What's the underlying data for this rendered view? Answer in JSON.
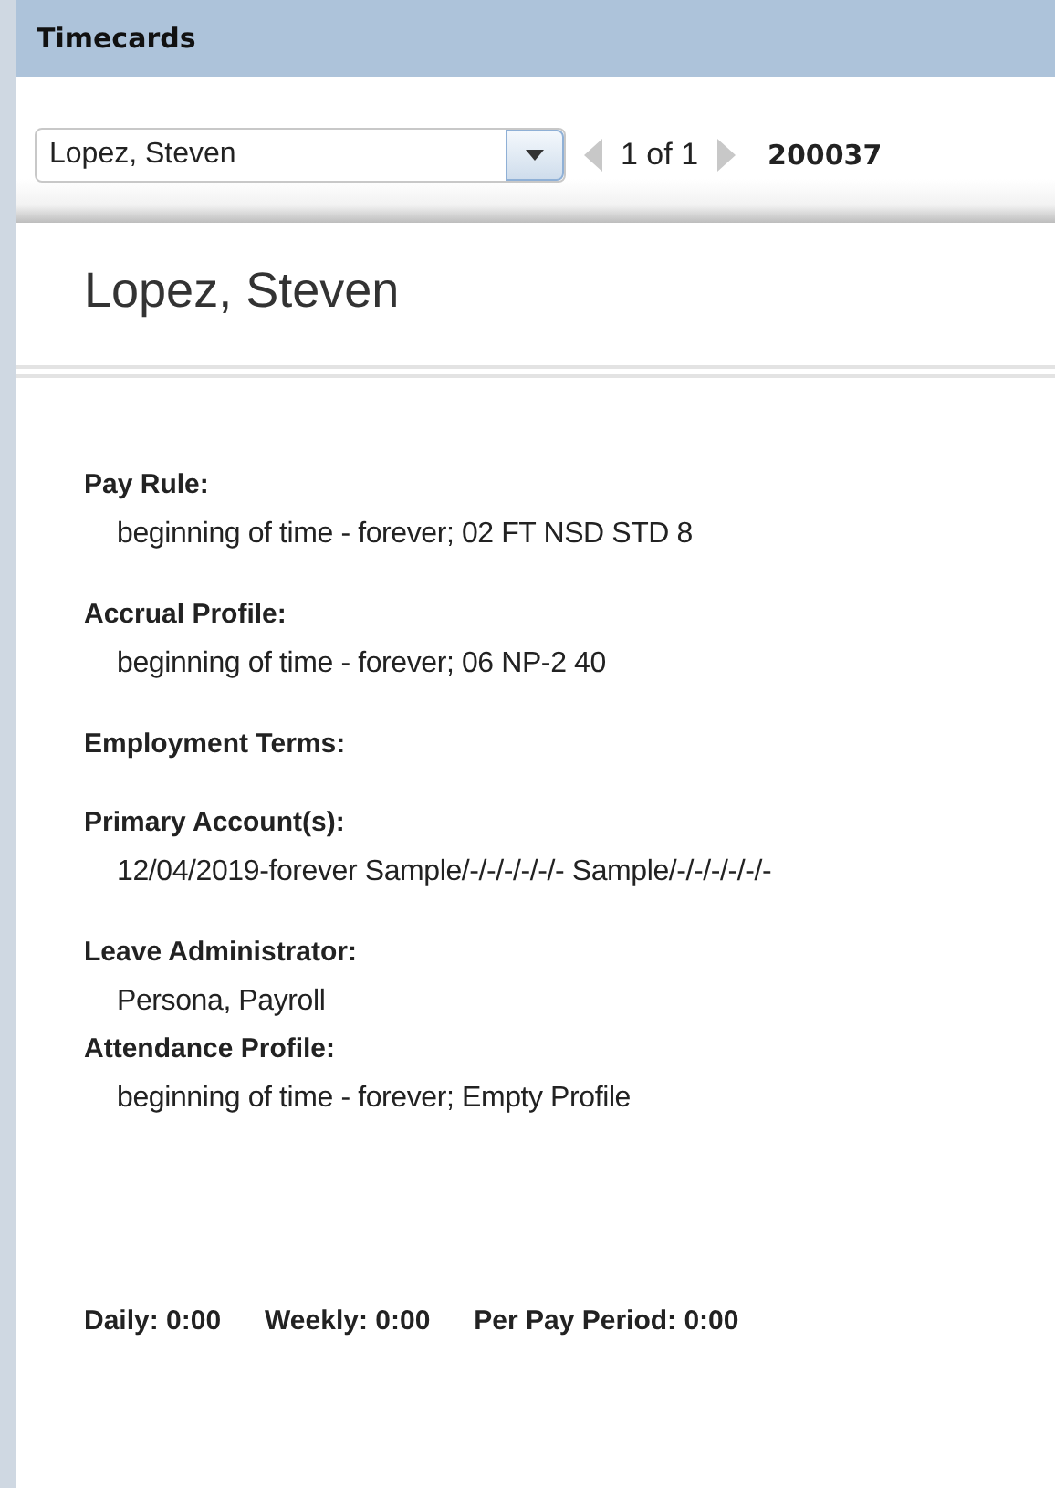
{
  "window": {
    "title": "Timecards"
  },
  "toolbar": {
    "employee_select": {
      "value": "Lopez, Steven"
    },
    "pager": {
      "text": "1 of 1",
      "prev_disabled": true,
      "next_disabled": true
    },
    "employee_id": "200037"
  },
  "heading": "Lopez, Steven",
  "fields": [
    {
      "label": "Pay Rule:",
      "value": "beginning of time - forever; 02 FT NSD STD 8"
    },
    {
      "label": "Accrual Profile:",
      "value": "beginning of time - forever; 06 NP-2 40"
    },
    {
      "label": "Employment Terms:"
    },
    {
      "label": "Primary Account(s):",
      "value": "12/04/2019-forever Sample/-/-/-/-/-/- Sample/-/-/-/-/-/-"
    },
    {
      "label": "Leave Administrator:",
      "value": "Persona, Payroll"
    },
    {
      "label": "Attendance Profile:",
      "value": "beginning of time - forever; Empty Profile"
    }
  ],
  "totals": [
    "Daily: 0:00",
    "Weekly: 0:00",
    "Per Pay Period: 0:00"
  ]
}
